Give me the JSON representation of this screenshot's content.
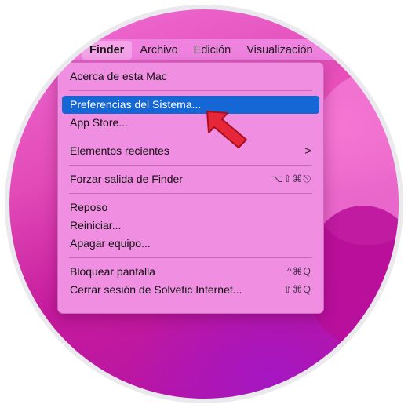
{
  "menubar": {
    "apple_glyph": "",
    "items": [
      "Finder",
      "Archivo",
      "Edición",
      "Visualización"
    ]
  },
  "menu": {
    "about": "Acerca de esta Mac",
    "system_prefs": "Preferencias del Sistema...",
    "app_store": "App Store...",
    "recent_items": "Elementos recientes",
    "recent_chevron": ">",
    "force_quit": "Forzar salida de Finder",
    "force_quit_shortcut": "⌥⇧⌘⎋",
    "sleep": "Reposo",
    "restart": "Reiniciar...",
    "shutdown": "Apagar equipo...",
    "lock_screen": "Bloquear pantalla",
    "lock_screen_shortcut": "^⌘Q",
    "logout": "Cerrar sesión de Solvetic Internet...",
    "logout_shortcut": "⇧⌘Q"
  },
  "colors": {
    "selection": "#1567d6",
    "pointer_arrow": "#e8263a",
    "menu_background": "#f08ee2",
    "desktop": "#c51a9d"
  },
  "icons": {
    "apple": "apple-icon",
    "pointer": "pointer-arrow-icon",
    "submenu": "chevron-right-icon"
  }
}
